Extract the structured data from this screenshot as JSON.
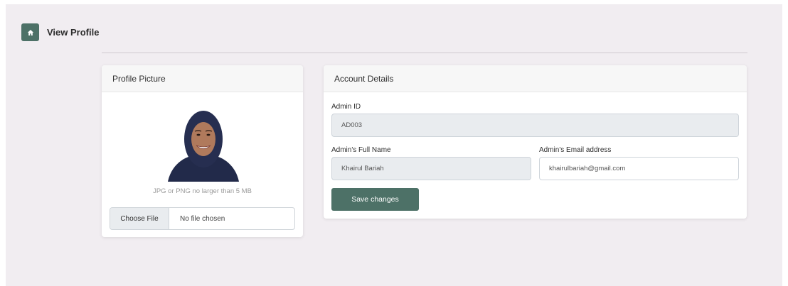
{
  "header": {
    "title": "View Profile",
    "home_icon": "home-icon"
  },
  "colors": {
    "accent": "#4d7167",
    "background": "#f1edf1"
  },
  "profile_card": {
    "title": "Profile Picture",
    "hint": "JPG or PNG no larger than 5 MB",
    "file_button": "Choose File",
    "file_status": "No file chosen"
  },
  "account_card": {
    "title": "Account Details",
    "admin_id_label": "Admin ID",
    "admin_id_value": "AD003",
    "full_name_label": "Admin's Full Name",
    "full_name_value": "Khairul Bariah",
    "email_label": "Admin's Email address",
    "email_value": "khairulbariah@gmail.com",
    "save_label": "Save changes"
  }
}
